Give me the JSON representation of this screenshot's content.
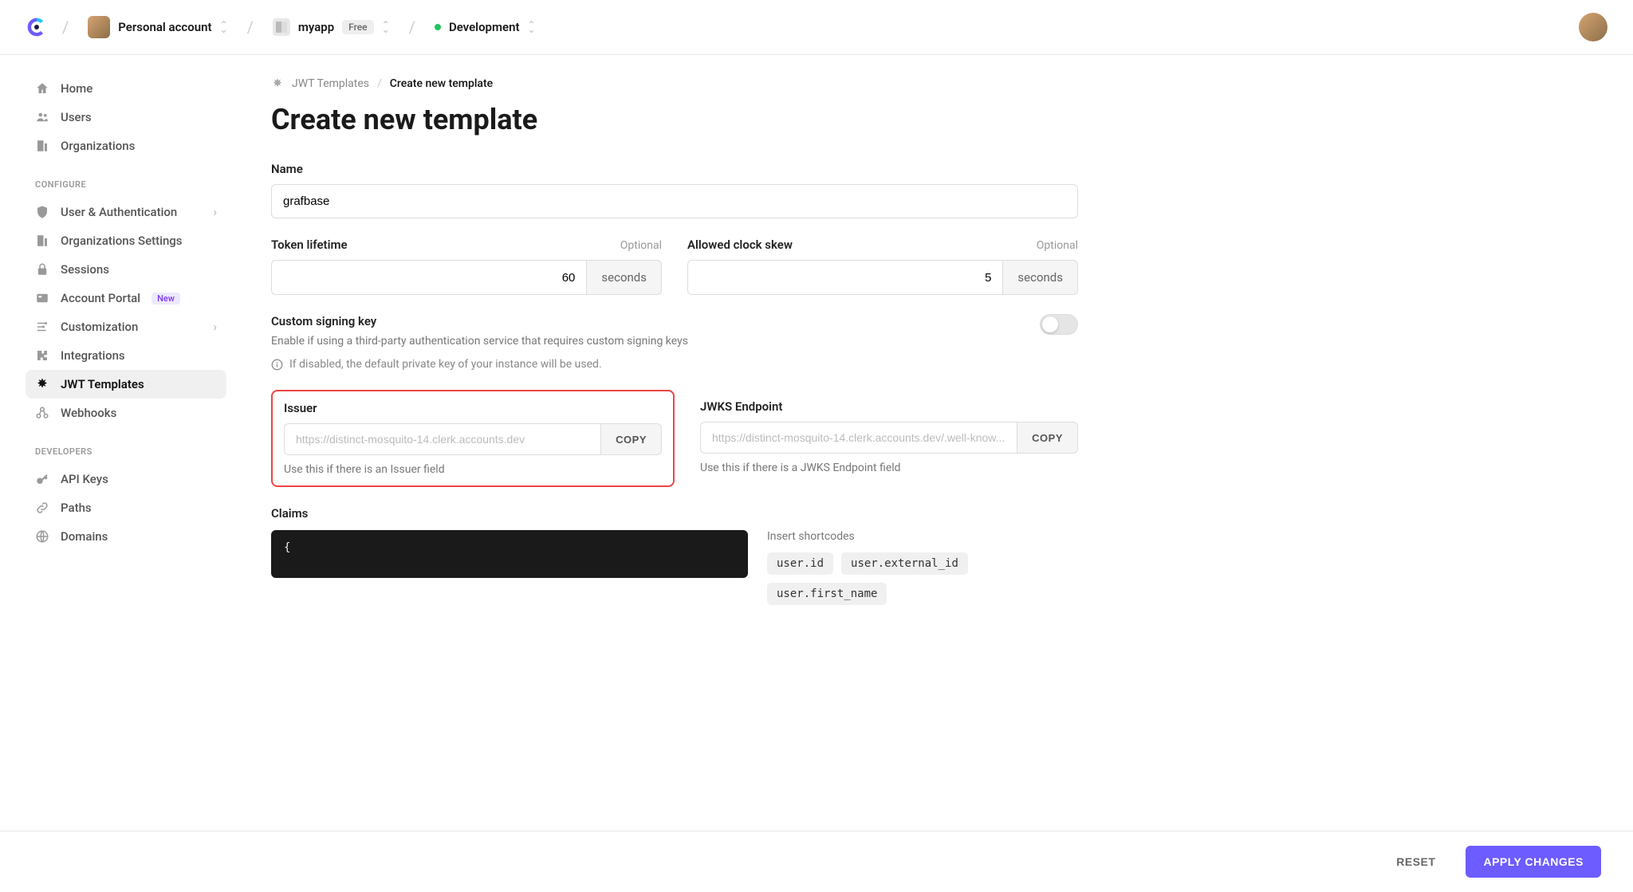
{
  "header": {
    "account_label": "Personal account",
    "app_name": "myapp",
    "plan_badge": "Free",
    "env_label": "Development"
  },
  "sidebar": {
    "main": [
      {
        "label": "Home"
      },
      {
        "label": "Users"
      },
      {
        "label": "Organizations"
      }
    ],
    "configure_title": "CONFIGURE",
    "configure": [
      {
        "label": "User & Authentication"
      },
      {
        "label": "Organizations Settings"
      },
      {
        "label": "Sessions"
      },
      {
        "label": "Account Portal",
        "badge": "New"
      },
      {
        "label": "Customization"
      },
      {
        "label": "Integrations"
      },
      {
        "label": "JWT Templates"
      },
      {
        "label": "Webhooks"
      }
    ],
    "developers_title": "DEVELOPERS",
    "developers": [
      {
        "label": "API Keys"
      },
      {
        "label": "Paths"
      },
      {
        "label": "Domains"
      }
    ]
  },
  "breadcrumb": {
    "parent": "JWT Templates",
    "current": "Create new template"
  },
  "page_title": "Create new template",
  "form": {
    "name_label": "Name",
    "name_value": "grafbase",
    "token_lifetime_label": "Token lifetime",
    "token_lifetime_value": "60",
    "token_lifetime_unit": "seconds",
    "clock_skew_label": "Allowed clock skew",
    "clock_skew_value": "5",
    "clock_skew_unit": "seconds",
    "optional_tag": "Optional",
    "signing_label": "Custom signing key",
    "signing_desc": "Enable if using a third-party authentication service that requires custom signing keys",
    "signing_info": "If disabled, the default private key of your instance will be used.",
    "issuer_label": "Issuer",
    "issuer_value": "https://distinct-mosquito-14.clerk.accounts.dev",
    "issuer_help": "Use this if there is an Issuer field",
    "jwks_label": "JWKS Endpoint",
    "jwks_value": "https://distinct-mosquito-14.clerk.accounts.dev/.well-know...",
    "jwks_help": "Use this if there is a JWKS Endpoint field",
    "copy_label": "COPY",
    "claims_label": "Claims",
    "claims_code": "{",
    "shortcodes_label": "Insert shortcodes",
    "shortcodes": [
      "user.id",
      "user.external_id",
      "user.first_name"
    ]
  },
  "footer": {
    "reset": "RESET",
    "apply": "APPLY CHANGES"
  }
}
